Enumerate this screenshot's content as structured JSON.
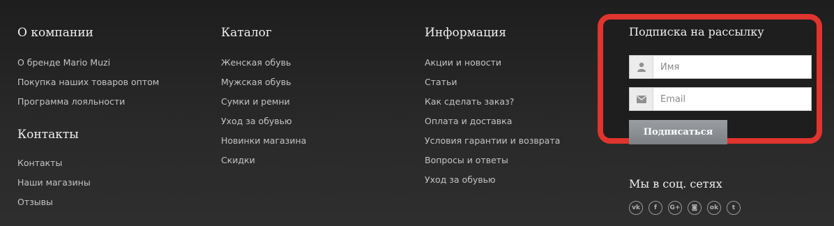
{
  "about": {
    "title": "О компании",
    "items": [
      "О бренде Mario Muzi",
      "Покупка наших товаров оптом",
      "Программа лояльности"
    ]
  },
  "contacts": {
    "title": "Контакты",
    "items": [
      "Контакты",
      "Наши магазины",
      "Отзывы"
    ]
  },
  "catalog": {
    "title": "Каталог",
    "items": [
      "Женская обувь",
      "Мужская обувь",
      "Сумки и ремни",
      "Уход за обувью",
      "Новинки магазина",
      "Скидки"
    ]
  },
  "info": {
    "title": "Информация",
    "items": [
      "Акции и новости",
      "Статьи",
      "Как сделать заказ?",
      "Оплата и доставка",
      "Условия гарантии и возврата",
      "Вопросы и ответы",
      "Уход за обувью"
    ]
  },
  "subscribe": {
    "title": "Подписка на рассылку",
    "name_placeholder": "Имя",
    "email_placeholder": "Email",
    "button_label": "Подписаться",
    "highlight_color": "#e0342e"
  },
  "social": {
    "title": "Мы в соц. сетях",
    "icons": [
      {
        "name": "vk-icon",
        "glyph": "vk"
      },
      {
        "name": "facebook-icon",
        "glyph": "f"
      },
      {
        "name": "google-plus-icon",
        "glyph": "G+"
      },
      {
        "name": "instagram-icon",
        "glyph": "◙"
      },
      {
        "name": "odnoklassniki-icon",
        "glyph": "ok"
      },
      {
        "name": "twitter-icon",
        "glyph": "t"
      }
    ]
  }
}
